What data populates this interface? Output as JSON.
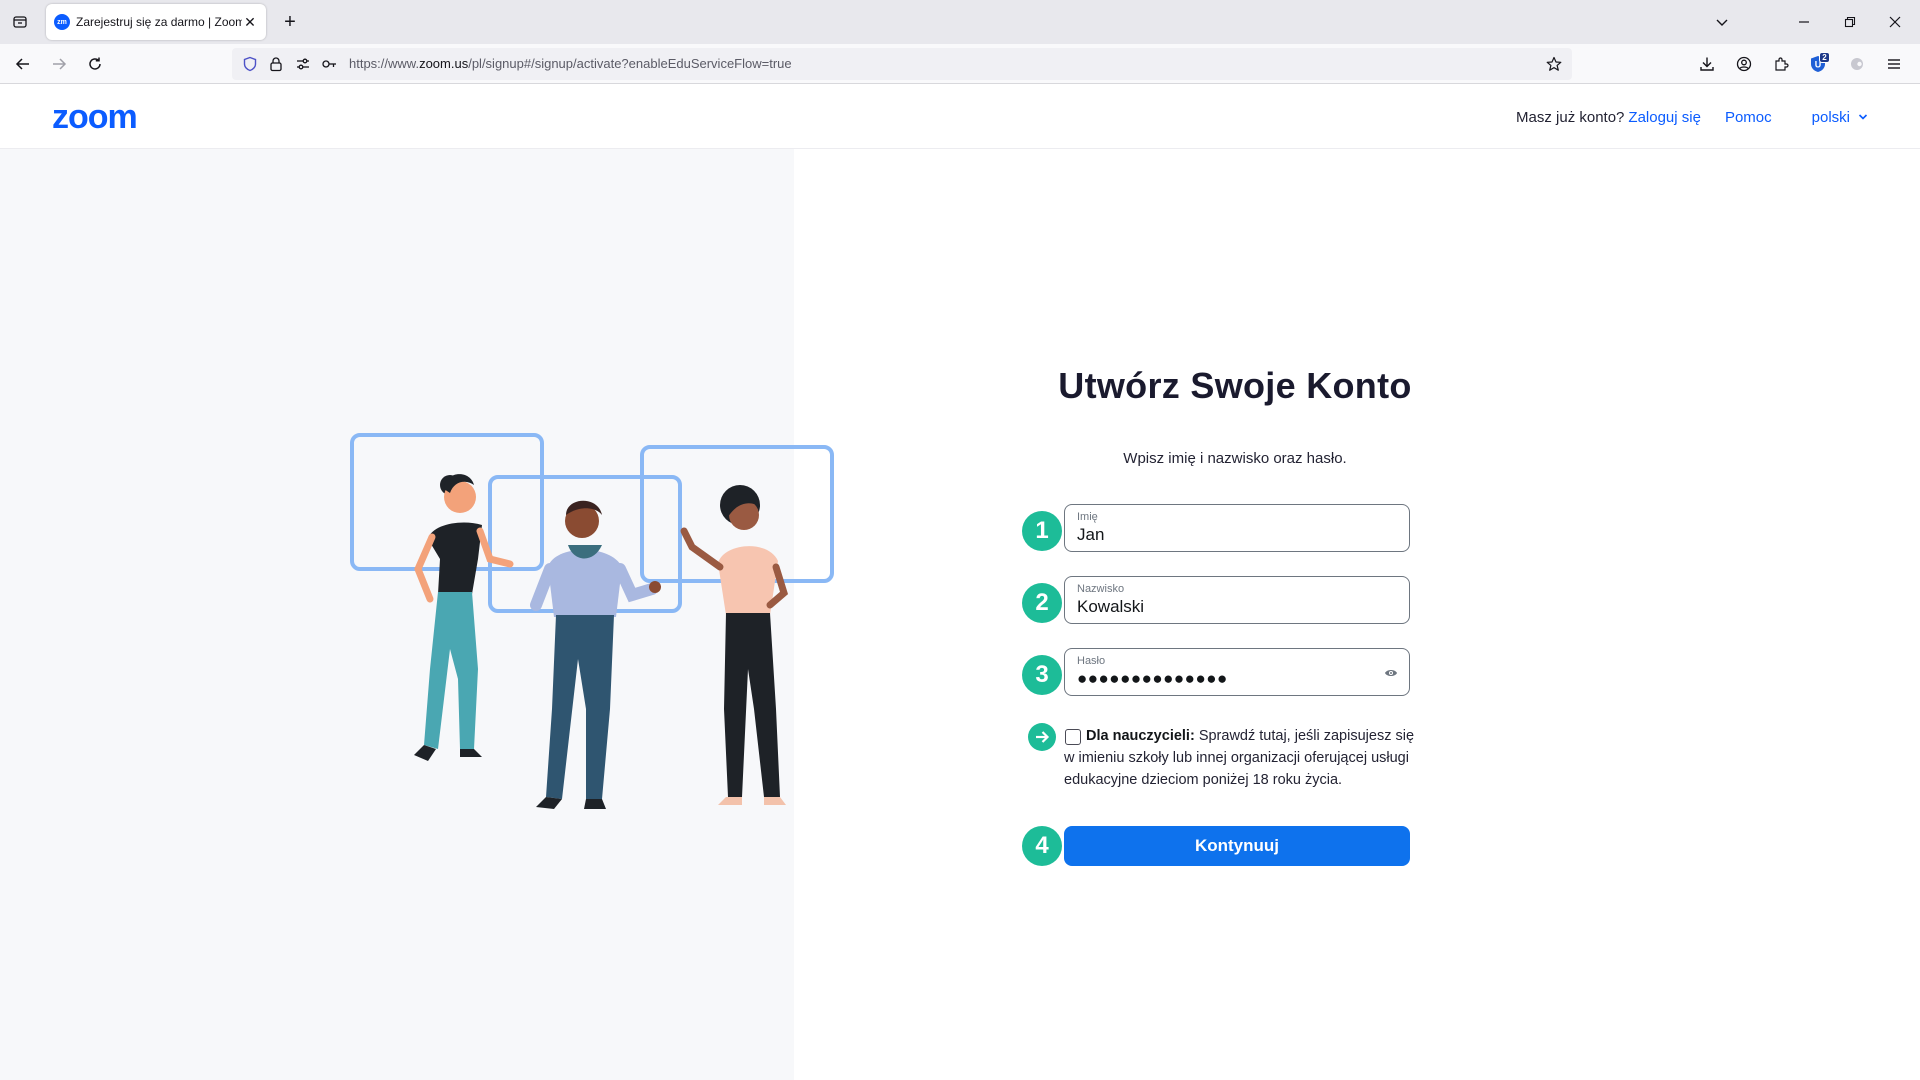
{
  "browser": {
    "tab_title": "Zarejestruj się za darmo | Zoom",
    "tab_favicon_text": "zm",
    "url_prefix": "https://www.",
    "url_host": "zoom.us",
    "url_path": "/pl/signup#/signup/activate?enableEduServiceFlow=true",
    "extension_badge": "2"
  },
  "header": {
    "logo_text": "zoom",
    "account_question": "Masz już konto?",
    "login_link": "Zaloguj się",
    "help_link": "Pomoc",
    "language": "polski"
  },
  "form": {
    "title": "Utwórz Swoje Konto",
    "subtitle": "Wpisz imię i nazwisko oraz hasło.",
    "first_name": {
      "step": "1",
      "label": "Imię",
      "value": "Jan"
    },
    "last_name": {
      "step": "2",
      "label": "Nazwisko",
      "value": "Kowalski"
    },
    "password": {
      "step": "3",
      "label": "Hasło",
      "masked_value": "●●●●●●●●●●●●●●"
    },
    "teachers": {
      "bold": "Dla nauczycieli:",
      "text": " Sprawdź tutaj, jeśli zapisujesz się w imieniu szkoły lub innej organizacji oferującej usługi edukacyjne dzieciom poniżej 18 roku życia.",
      "checked": false
    },
    "continue": {
      "step": "4",
      "label": "Kontynuuj"
    }
  },
  "colors": {
    "brand_blue": "#0b5cff",
    "button_blue": "#0e72ed",
    "step_green": "#1dbc98"
  }
}
